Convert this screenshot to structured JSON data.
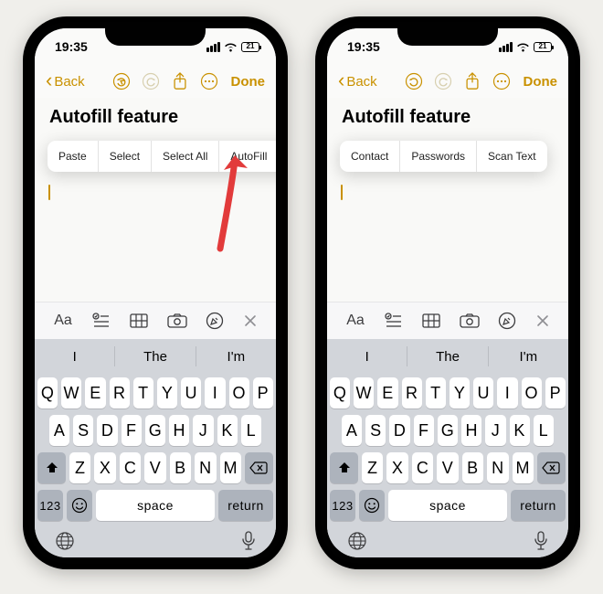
{
  "status": {
    "time": "19:35",
    "battery_label": "21"
  },
  "nav": {
    "back_label": "Back",
    "done_label": "Done"
  },
  "note": {
    "title": "Autofill feature"
  },
  "edit_menu": {
    "screen1": [
      "Paste",
      "Select",
      "Select All",
      "AutoFill"
    ],
    "screen2": [
      "Contact",
      "Passwords",
      "Scan Text"
    ]
  },
  "format_bar": {
    "aa": "Aa"
  },
  "predictions": [
    "I",
    "The",
    "I'm"
  ],
  "keys": {
    "row1": [
      "Q",
      "W",
      "E",
      "R",
      "T",
      "Y",
      "U",
      "I",
      "O",
      "P"
    ],
    "row2": [
      "A",
      "S",
      "D",
      "F",
      "G",
      "H",
      "J",
      "K",
      "L"
    ],
    "row3": [
      "Z",
      "X",
      "C",
      "V",
      "B",
      "N",
      "M"
    ],
    "num": "123",
    "space": "space",
    "ret": "return"
  }
}
